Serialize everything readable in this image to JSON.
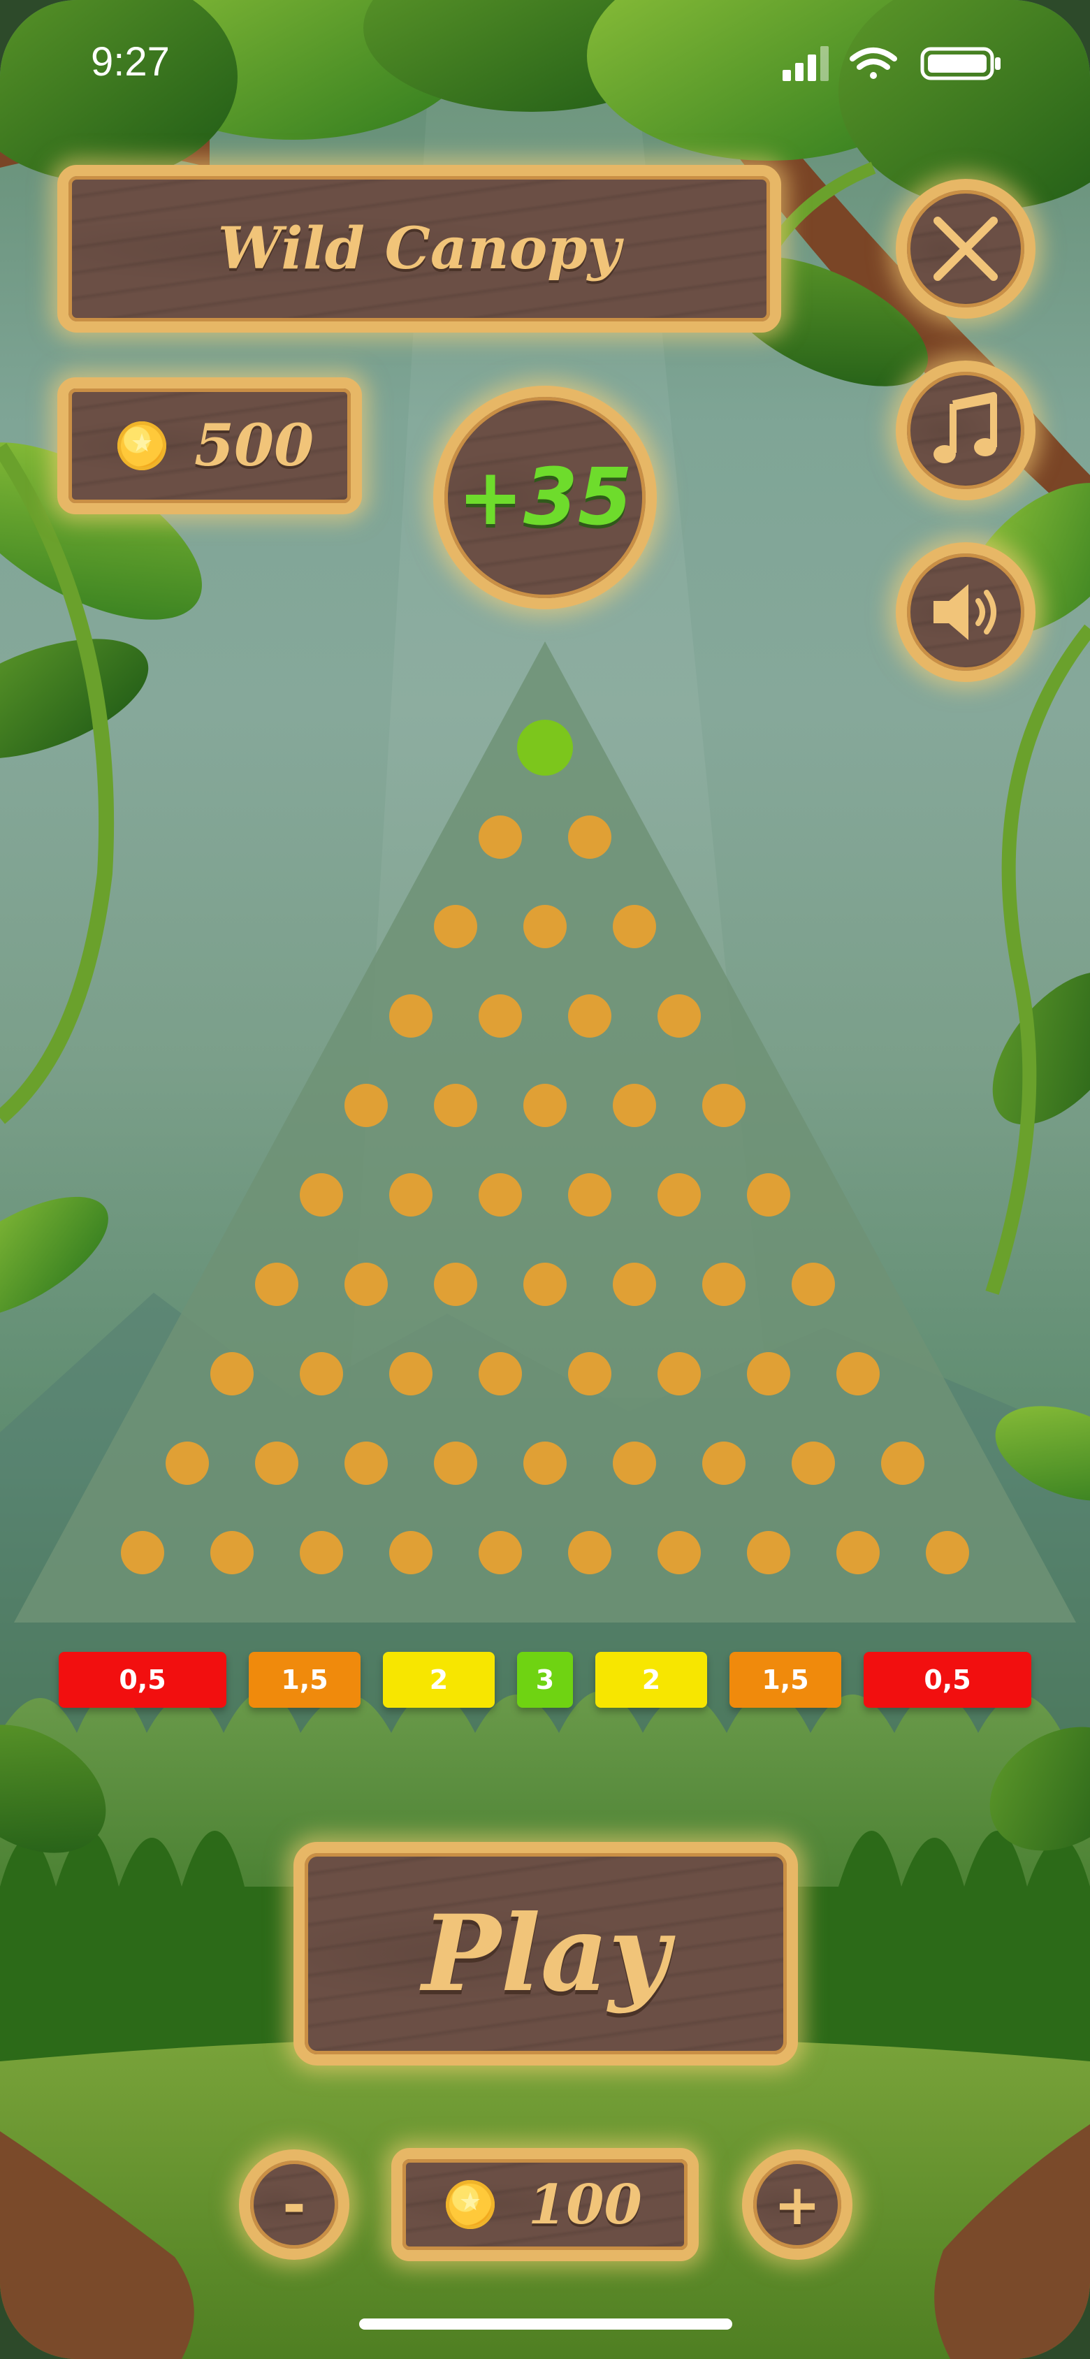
{
  "status_bar": {
    "time": "9:27",
    "icons": [
      "cellular-signal-icon",
      "wifi-icon",
      "battery-icon"
    ]
  },
  "header": {
    "title": "Wild Canopy"
  },
  "balance": {
    "icon": "coin-icon",
    "value": "500"
  },
  "last_win": {
    "value": "+35"
  },
  "controls": {
    "close_icon": "close-icon",
    "music_icon": "music-note-icon",
    "sound_icon": "speaker-icon"
  },
  "board": {
    "rows": 10,
    "active_ball_color": "#7cc61c",
    "peg_color": "#e0a035"
  },
  "multipliers": [
    {
      "label": "0,5",
      "color": "#f20f0f"
    },
    {
      "label": "1,5",
      "color": "#f08a0c"
    },
    {
      "label": "2",
      "color": "#f7e600"
    },
    {
      "label": "3",
      "color": "#6fd312"
    },
    {
      "label": "2",
      "color": "#f7e600"
    },
    {
      "label": "1,5",
      "color": "#f08a0c"
    },
    {
      "label": "0,5",
      "color": "#f20f0f"
    }
  ],
  "play": {
    "label": "Play"
  },
  "bet": {
    "minus_label": "-",
    "plus_label": "+",
    "value": "100",
    "icon": "coin-icon"
  },
  "colors": {
    "wood": "#6b4f45",
    "wood_border": "#e7b766",
    "title_text": "#f1c479",
    "win_text": "#6edc2c"
  }
}
